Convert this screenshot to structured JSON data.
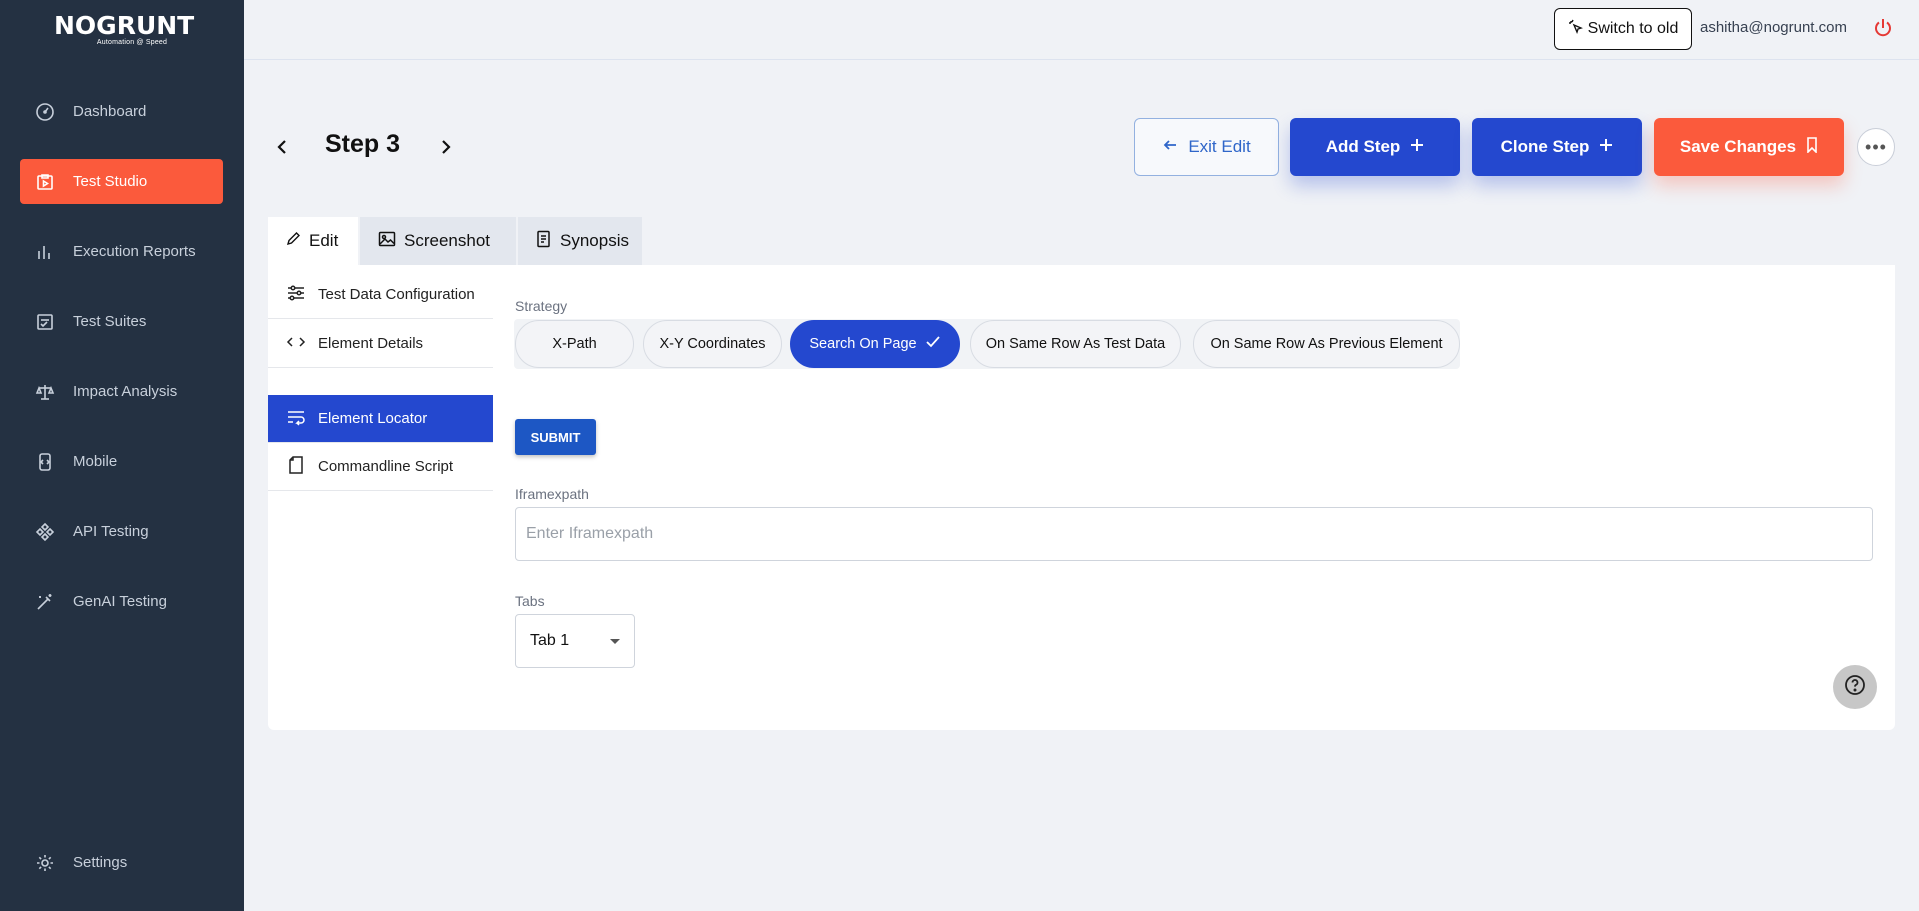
{
  "brand": {
    "name": "NOGRUNT",
    "tagline": "Automation @ Speed"
  },
  "sidebar": {
    "items": [
      {
        "label": "Dashboard",
        "icon": "gauge-icon"
      },
      {
        "label": "Test Studio",
        "icon": "clipboard-play-icon",
        "active": true
      },
      {
        "label": "Execution Reports",
        "icon": "bar-chart-icon"
      },
      {
        "label": "Test Suites",
        "icon": "checklist-icon"
      },
      {
        "label": "Impact Analysis",
        "icon": "scale-icon"
      },
      {
        "label": "Mobile",
        "icon": "mobile-icon"
      },
      {
        "label": "API Testing",
        "icon": "api-icon"
      },
      {
        "label": "GenAI Testing",
        "icon": "magic-wand-icon"
      }
    ],
    "settings_label": "Settings"
  },
  "header": {
    "switch_label": "Switch to old",
    "user_email": "ashitha@nogrunt.com"
  },
  "step": {
    "title": "Step 3",
    "exit_label": "Exit Edit",
    "add_label": "Add Step",
    "clone_label": "Clone Step",
    "save_label": "Save Changes"
  },
  "tabs": [
    {
      "label": "Edit",
      "active": true
    },
    {
      "label": "Screenshot"
    },
    {
      "label": "Synopsis"
    }
  ],
  "subnav": [
    {
      "label": "Test Data Configuration"
    },
    {
      "label": "Element Details"
    },
    {
      "label": "Element Locator",
      "active": true
    },
    {
      "label": "Commandline Script"
    }
  ],
  "form": {
    "strategy_label": "Strategy",
    "strategies": [
      {
        "label": "X-Path"
      },
      {
        "label": "X-Y Coordinates"
      },
      {
        "label": "Search On Page",
        "selected": true
      },
      {
        "label": "On Same Row As Test Data"
      },
      {
        "label": "On Same Row As Previous Element"
      }
    ],
    "submit_label": "SUBMIT",
    "iframe_label": "Iframexpath",
    "iframe_placeholder": "Enter Iframexpath",
    "tabs_label": "Tabs",
    "tabs_value": "Tab 1"
  },
  "colors": {
    "sidebar_bg": "#243142",
    "accent_orange": "#fb5a3c",
    "primary_blue": "#2448cf"
  }
}
